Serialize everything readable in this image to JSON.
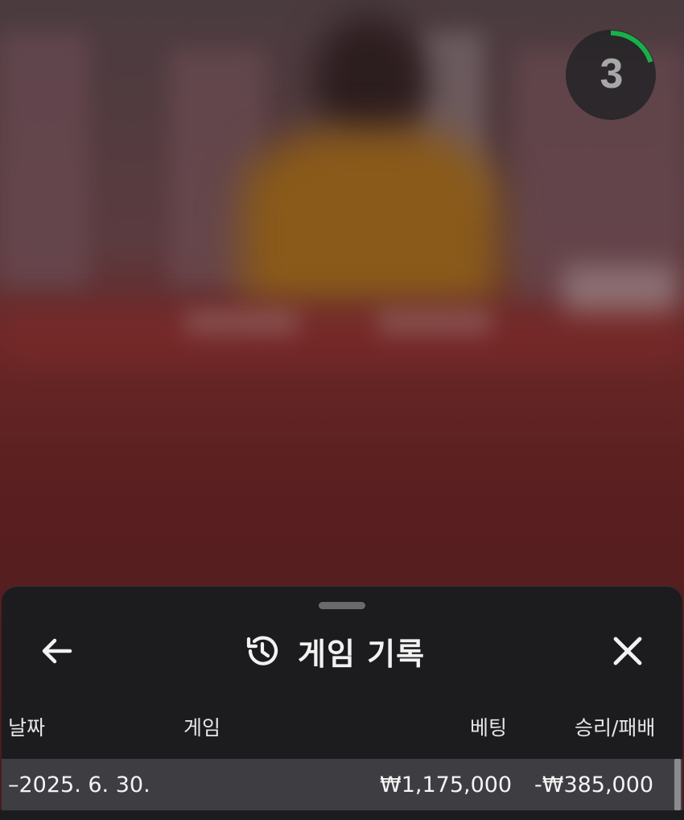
{
  "video": {
    "countdown": "3",
    "countdown_progress": 0.2,
    "accent_color": "#18b04a"
  },
  "history_panel": {
    "title": "게임 기록",
    "icons": {
      "back": "arrow-left-icon",
      "history": "history-clock-icon",
      "close": "close-icon"
    },
    "columns": {
      "date": "날짜",
      "game": "게임",
      "bet": "베팅",
      "result": "승리/패배"
    },
    "rows": [
      {
        "date": "–2025. 6. 30.",
        "game": "",
        "bet": "₩1,175,000",
        "result": "-₩385,000"
      }
    ]
  }
}
